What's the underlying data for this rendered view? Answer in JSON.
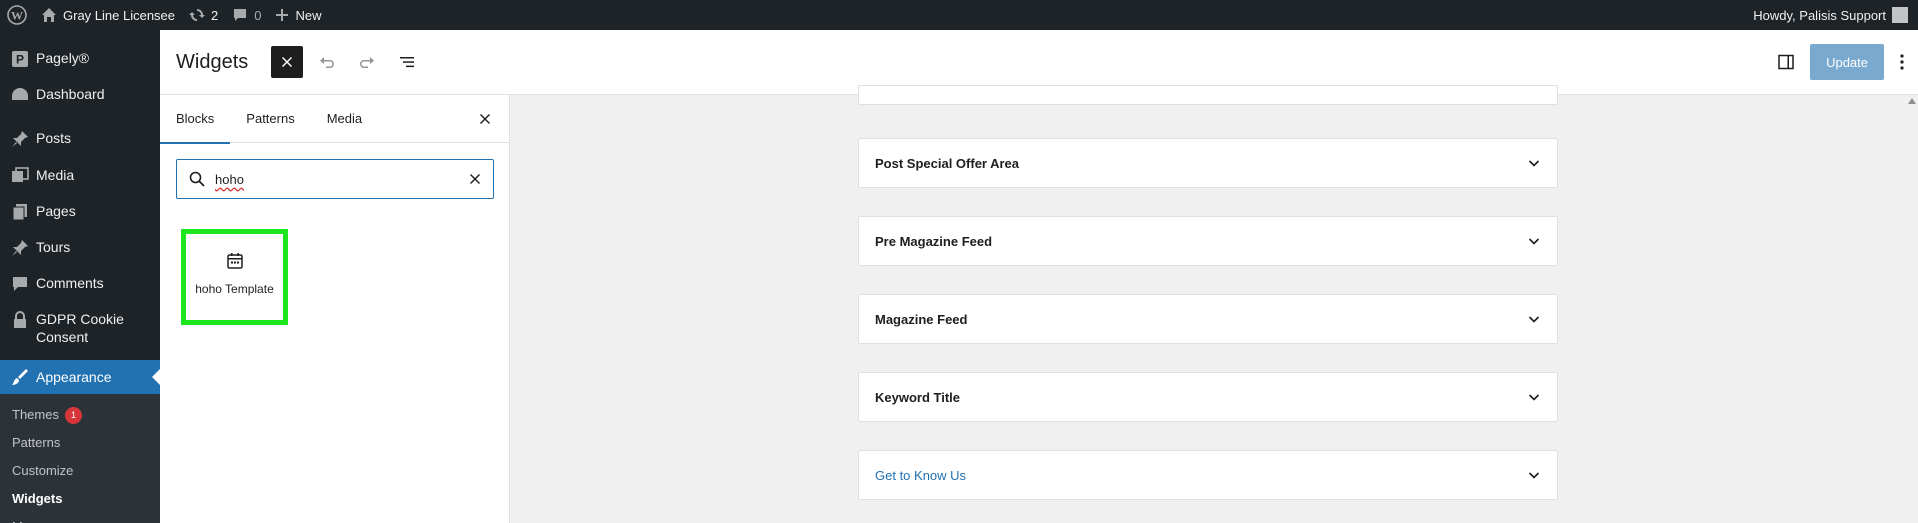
{
  "admin_bar": {
    "site_name": "Gray Line Licensee",
    "updates_count": "2",
    "comments_count": "0",
    "new_label": "New",
    "greeting": "Howdy, Palisis Support"
  },
  "sidebar": {
    "items": [
      {
        "label": "Pagely®",
        "icon": "pagely-icon"
      },
      {
        "label": "Dashboard",
        "icon": "dashboard-icon"
      },
      {
        "label": "Posts",
        "icon": "pin-icon"
      },
      {
        "label": "Media",
        "icon": "media-icon"
      },
      {
        "label": "Pages",
        "icon": "pages-icon"
      },
      {
        "label": "Tours",
        "icon": "pin-icon"
      },
      {
        "label": "Comments",
        "icon": "comment-icon"
      },
      {
        "label": "GDPR Cookie Consent",
        "icon": "lock-icon"
      },
      {
        "label": "Appearance",
        "icon": "brush-icon"
      }
    ],
    "submenu": [
      {
        "label": "Themes",
        "badge": "1"
      },
      {
        "label": "Patterns"
      },
      {
        "label": "Customize"
      },
      {
        "label": "Widgets"
      },
      {
        "label": "Menus"
      }
    ]
  },
  "editor_header": {
    "title": "Widgets",
    "update_label": "Update"
  },
  "inserter": {
    "tabs": [
      "Blocks",
      "Patterns",
      "Media"
    ],
    "search_value": "hoho",
    "result_label": "hoho Template"
  },
  "widget_areas": [
    "Post Special Offer Area",
    "Pre Magazine Feed",
    "Magazine Feed",
    "Keyword Title",
    "Get to Know Us"
  ],
  "colors": {
    "accent": "#2271b1",
    "admin_dark": "#1d2327",
    "highlight_border": "#1ee61e",
    "badge": "#d63638"
  }
}
